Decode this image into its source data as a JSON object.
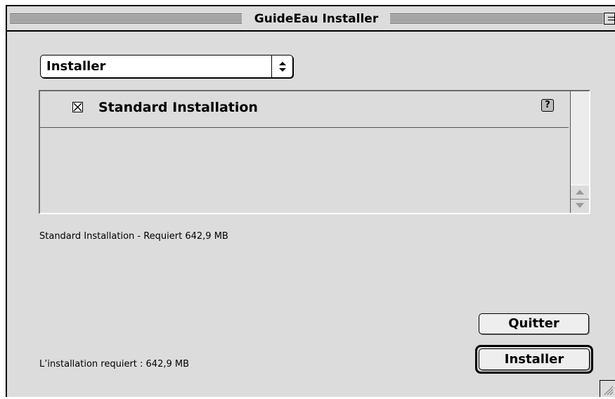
{
  "window": {
    "title": "GuideEau Installer"
  },
  "popup": {
    "selected": "Installer",
    "arrows_icon": "updown-arrows-icon"
  },
  "list": {
    "items": [
      {
        "label": "Standard Installation",
        "checked": true,
        "help_icon": "?"
      }
    ]
  },
  "info": {
    "description": "Standard Installation - Requiert 642,9 MB",
    "requirement": "L’installation requiert : 642,9 MB"
  },
  "buttons": {
    "quit_label": "Quitter",
    "install_label": "Installer"
  }
}
